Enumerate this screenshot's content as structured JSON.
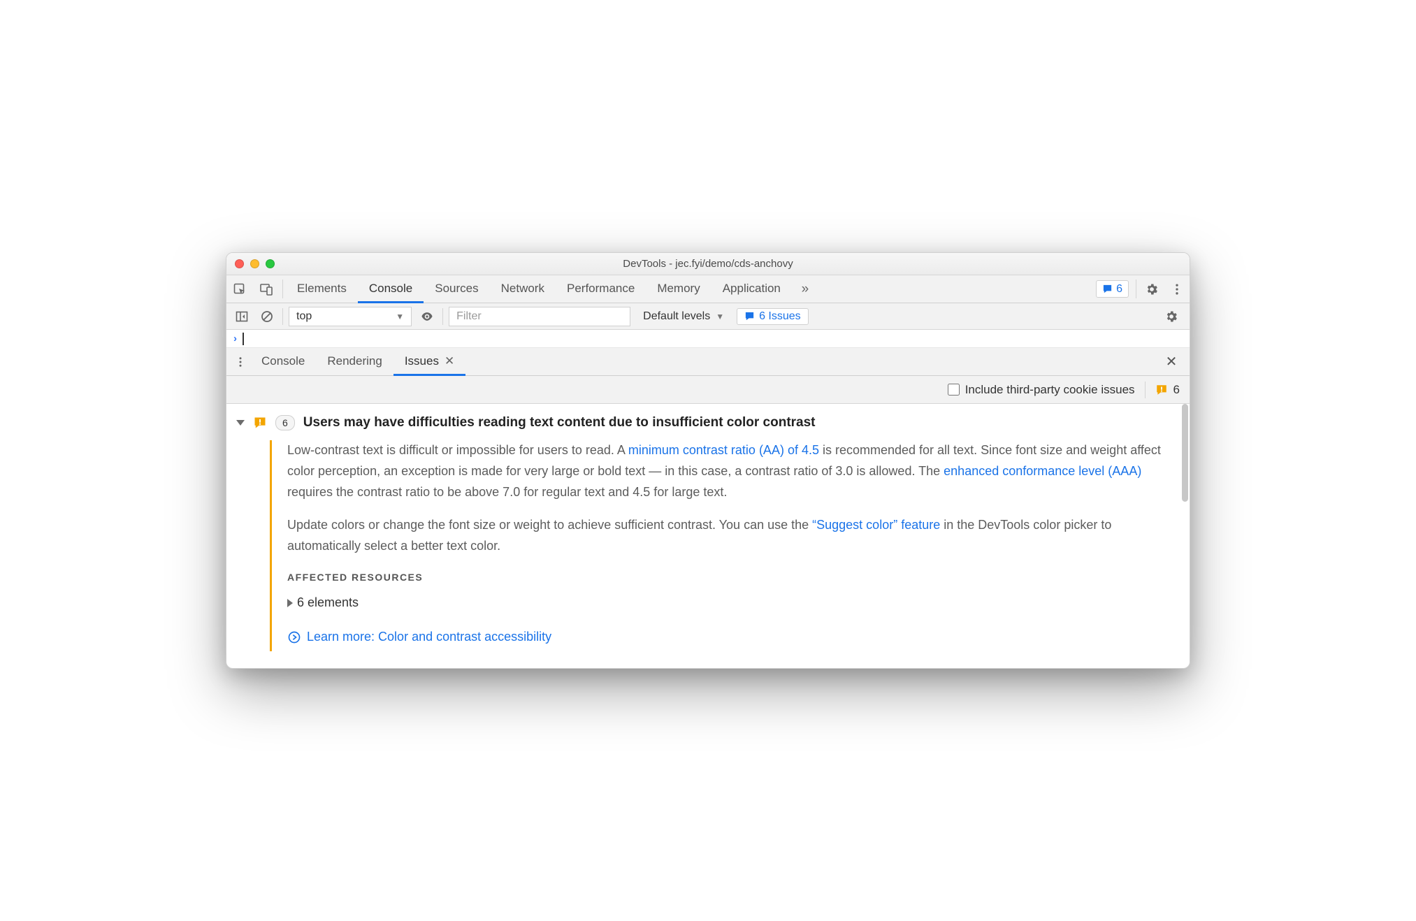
{
  "window": {
    "title": "DevTools - jec.fyi/demo/cds-anchovy"
  },
  "mainTabs": {
    "items": [
      "Elements",
      "Console",
      "Sources",
      "Network",
      "Performance",
      "Memory",
      "Application"
    ],
    "activeIndex": 1,
    "badgeCount": "6"
  },
  "consoleToolbar": {
    "context": "top",
    "filterPlaceholder": "Filter",
    "levels": "Default levels",
    "issuesLabel": "6 Issues"
  },
  "drawerTabs": {
    "items": [
      "Console",
      "Rendering",
      "Issues"
    ],
    "activeIndex": 2
  },
  "issuesBar": {
    "checkboxLabel": "Include third-party cookie issues",
    "count": "6"
  },
  "issue": {
    "count": "6",
    "title": "Users may have difficulties reading text content due to insufficient color contrast",
    "p1_pre": "Low-contrast text is difficult or impossible for users to read. A ",
    "p1_link1": "minimum contrast ratio (AA) of 4.5",
    "p1_mid": " is recommended for all text. Since font size and weight affect color perception, an exception is made for very large or bold text — in this case, a contrast ratio of 3.0 is allowed. The ",
    "p1_link2": "enhanced conformance level (AAA)",
    "p1_post": " requires the contrast ratio to be above 7.0 for regular text and 4.5 for large text.",
    "p2_pre": "Update colors or change the font size or weight to achieve sufficient contrast. You can use the ",
    "p2_link": "“Suggest color” feature",
    "p2_post": " in the DevTools color picker to automatically select a better text color.",
    "affectedHeading": "AFFECTED RESOURCES",
    "affectedRow": "6 elements",
    "learnMore": "Learn more: Color and contrast accessibility"
  }
}
